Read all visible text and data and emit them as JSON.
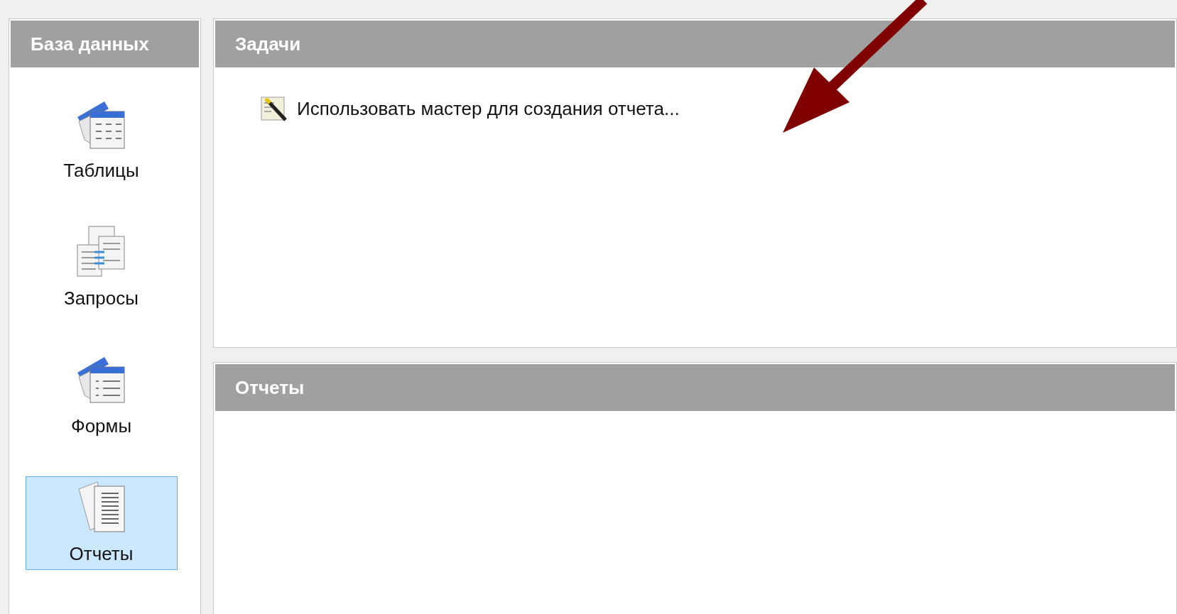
{
  "sidebar": {
    "title": "База данных",
    "items": [
      {
        "label": "Таблицы",
        "kind": "tables",
        "selected": false
      },
      {
        "label": "Запросы",
        "kind": "queries",
        "selected": false
      },
      {
        "label": "Формы",
        "kind": "forms",
        "selected": false
      },
      {
        "label": "Отчеты",
        "kind": "reports",
        "selected": true
      }
    ]
  },
  "tasks": {
    "title": "Задачи",
    "items": [
      {
        "label": "Использовать мастер для создания отчета..."
      }
    ]
  },
  "reports": {
    "title": "Отчеты"
  }
}
